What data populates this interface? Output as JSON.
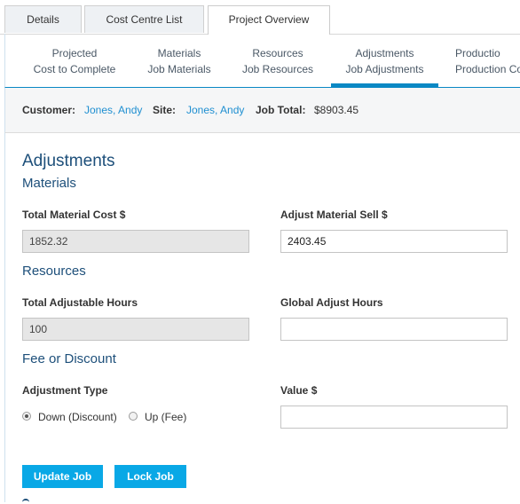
{
  "top_tabs": [
    "Details",
    "Cost Centre List",
    "Project Overview"
  ],
  "sub_tabs": [
    {
      "line1": "Projected",
      "line2": "Cost to Complete"
    },
    {
      "line1": "Materials",
      "line2": "Job Materials"
    },
    {
      "line1": "Resources",
      "line2": "Job Resources"
    },
    {
      "line1": "Adjustments",
      "line2": "Job Adjustments"
    },
    {
      "line1": "Productio",
      "line2": "Production Co"
    }
  ],
  "info": {
    "customer_label": "Customer:",
    "customer_value": "Jones, Andy",
    "site_label": "Site:",
    "site_value": "Jones, Andy",
    "job_total_label": "Job Total:",
    "job_total_value": "$8903.45"
  },
  "page_title": "Adjustments",
  "materials": {
    "heading": "Materials",
    "total_cost_label": "Total Material Cost $",
    "total_cost_value": "1852.32",
    "adjust_sell_label": "Adjust Material Sell $",
    "adjust_sell_value": "2403.45"
  },
  "resources": {
    "heading": "Resources",
    "total_hours_label": "Total Adjustable Hours",
    "total_hours_value": "100",
    "global_adjust_label": "Global Adjust Hours",
    "global_adjust_value": ""
  },
  "fee": {
    "heading": "Fee or Discount",
    "type_label": "Adjustment Type",
    "option_down": "Down (Discount)",
    "option_up": "Up (Fee)",
    "selected": "down",
    "value_label": "Value $",
    "value": ""
  },
  "buttons": {
    "update": "Update Job",
    "lock": "Lock Job"
  },
  "colors": {
    "accent": "#0a88c4",
    "button": "#09a8e6",
    "heading": "#1d4f7a",
    "link": "#1f8fd1"
  }
}
